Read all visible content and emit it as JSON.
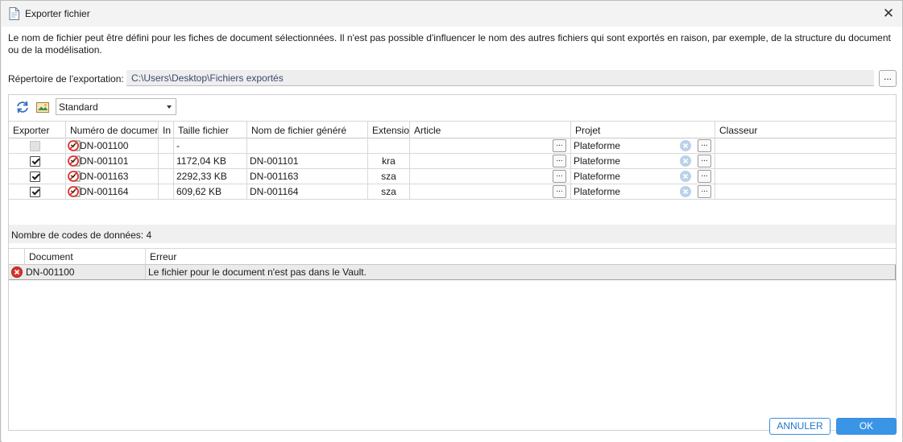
{
  "window": {
    "title": "Exporter fichier",
    "close_glyph": "✕"
  },
  "description": "Le nom de fichier peut être défini pour les fiches de document sélectionnées. Il n'est pas possible d'influencer le nom des autres fichiers qui sont exportés en raison, par exemple, de la structure du document ou de la modélisation.",
  "export_dir": {
    "label": "Répertoire de l'exportation:",
    "value": "C:\\Users\\Desktop\\Fichiers exportés",
    "browse_label": "..."
  },
  "toolbar": {
    "view_selected": "Standard"
  },
  "grid": {
    "columns": [
      "Exporter",
      "Numéro de document",
      "In",
      "Taille fichier",
      "Nom de fichier généré",
      "Extension",
      "Article",
      "Projet",
      "Classeur"
    ],
    "rows": [
      {
        "exporter": "disabled",
        "numero": "DN-001100",
        "in": "",
        "taille": "-",
        "nom": "",
        "ext": "",
        "article": "",
        "projet": "Plateforme",
        "classeur": ""
      },
      {
        "exporter": "checked",
        "numero": "DN-001101",
        "in": "",
        "taille": "1172,04 KB",
        "nom": "DN-001101",
        "ext": "kra",
        "article": "",
        "projet": "Plateforme",
        "classeur": ""
      },
      {
        "exporter": "checked",
        "numero": "DN-001163",
        "in": "",
        "taille": "2292,33 KB",
        "nom": "DN-001163",
        "ext": "sza",
        "article": "",
        "projet": "Plateforme",
        "classeur": ""
      },
      {
        "exporter": "checked",
        "numero": "DN-001164",
        "in": "",
        "taille": "609,62 KB",
        "nom": "DN-001164",
        "ext": "sza",
        "article": "",
        "projet": "Plateforme",
        "classeur": ""
      }
    ],
    "cell_button_label": "..."
  },
  "status": "Nombre de codes de données: 4",
  "errors": {
    "columns": [
      "Document",
      "Erreur"
    ],
    "rows": [
      {
        "document": "DN-001100",
        "erreur": "Le fichier pour le document n'est pas dans le Vault."
      }
    ]
  },
  "buttons": {
    "cancel": "ANNULER",
    "ok": "OK"
  },
  "colors": {
    "accent": "#3b95e6",
    "error": "#d9342b",
    "clear": "#b9d2ea"
  }
}
